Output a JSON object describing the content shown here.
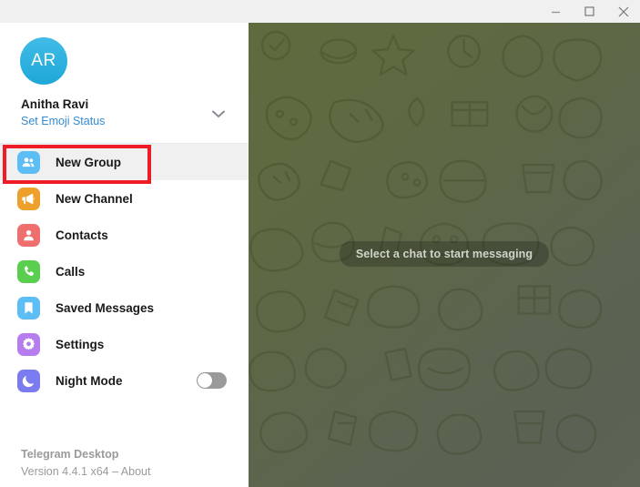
{
  "window": {
    "titlebar": {
      "minimize_label": "Minimize",
      "maximize_label": "Maximize",
      "close_label": "Close"
    }
  },
  "sidebar": {
    "account": {
      "avatar_initials": "AR",
      "name": "Anitha Ravi",
      "status_label": "Set Emoji Status",
      "chevron_icon": "chevron-down-icon",
      "avatar_color": "#2aafe0"
    },
    "menu": [
      {
        "label": "New Group",
        "icon": "new-group-icon",
        "color": "#5dbef5",
        "highlighted": true,
        "toggle": null
      },
      {
        "label": "New Channel",
        "icon": "megaphone-icon",
        "color": "#eea02c",
        "highlighted": false,
        "toggle": null
      },
      {
        "label": "Contacts",
        "icon": "contacts-icon",
        "color": "#ef6f6f",
        "highlighted": false,
        "toggle": null
      },
      {
        "label": "Calls",
        "icon": "phone-icon",
        "color": "#5ace4f",
        "highlighted": false,
        "toggle": null
      },
      {
        "label": "Saved Messages",
        "icon": "bookmark-icon",
        "color": "#5dbef5",
        "highlighted": false,
        "toggle": null
      },
      {
        "label": "Settings",
        "icon": "gear-icon",
        "color": "#b57ded",
        "highlighted": false,
        "toggle": null
      },
      {
        "label": "Night Mode",
        "icon": "moon-icon",
        "color": "#7a7cf0",
        "highlighted": false,
        "toggle": "off"
      }
    ],
    "footer": {
      "app_name": "Telegram Desktop",
      "version_line": "Version 4.4.1 x64 – About"
    }
  },
  "chat": {
    "placeholder_text": "Select a chat to start messaging",
    "background_color": "#5d6b3d"
  },
  "annotation": {
    "target": "New Group",
    "color": "#ee1c25"
  }
}
